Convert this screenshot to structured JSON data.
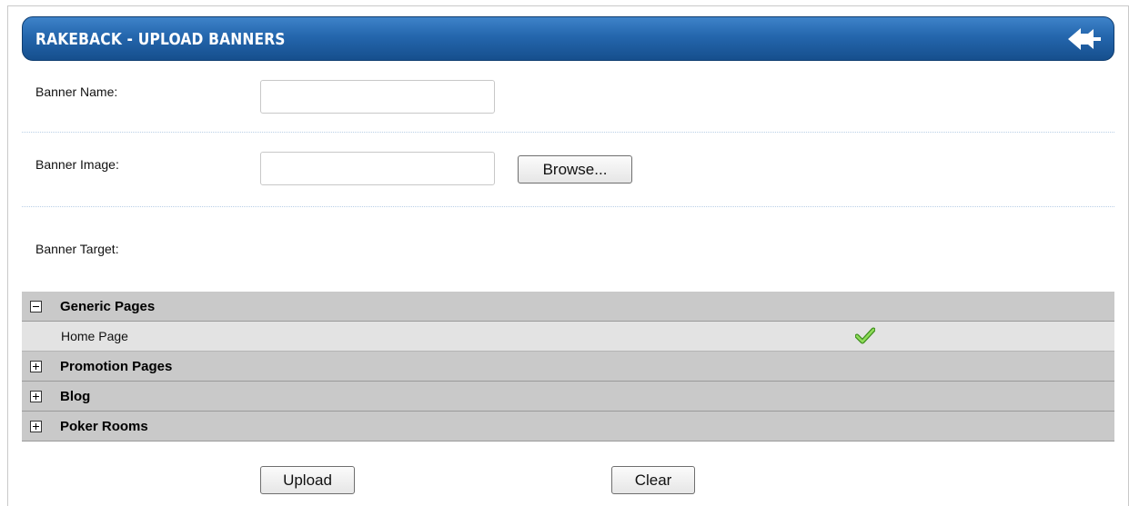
{
  "header": {
    "title": "RAKEBACK - UPLOAD BANNERS",
    "back_icon": "arrow-left-icon"
  },
  "form": {
    "banner_name": {
      "label": "Banner Name:",
      "value": "",
      "placeholder": ""
    },
    "banner_image": {
      "label": "Banner Image:",
      "value": "",
      "placeholder": "",
      "browse_label": "Browse..."
    },
    "banner_target": {
      "label": "Banner Target:"
    }
  },
  "tree": [
    {
      "label": "Generic Pages",
      "expanded": true,
      "children": [
        {
          "label": "Home Page",
          "selected": true
        }
      ]
    },
    {
      "label": "Promotion Pages",
      "expanded": false,
      "children": []
    },
    {
      "label": "Blog",
      "expanded": false,
      "children": []
    },
    {
      "label": "Poker Rooms",
      "expanded": false,
      "children": []
    }
  ],
  "actions": {
    "upload_label": "Upload",
    "clear_label": "Clear"
  },
  "colors": {
    "header_top": "#3e83c9",
    "header_bottom": "#164f8d",
    "group_row": "#c9c9c9",
    "child_row": "#e3e3e3",
    "check_green": "#5cb82e"
  }
}
